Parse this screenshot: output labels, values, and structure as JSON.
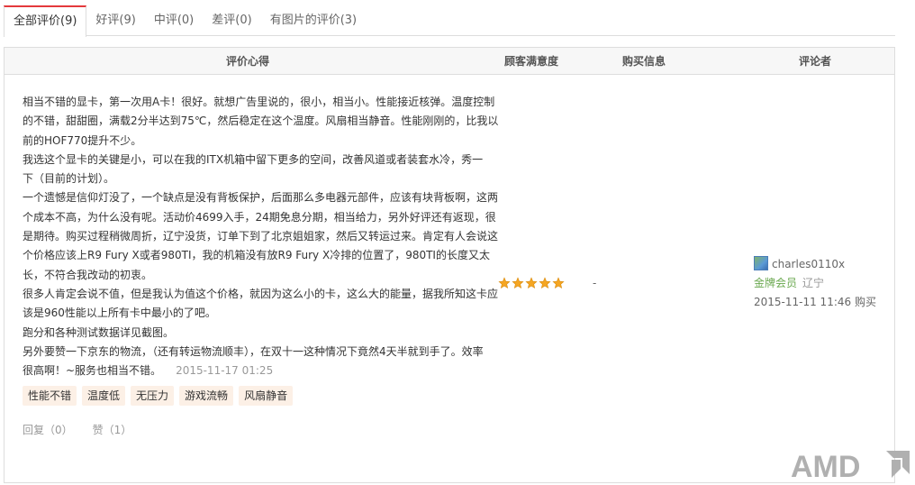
{
  "tabs": [
    {
      "label": "全部评价(9)",
      "active": true
    },
    {
      "label": "好评(9)"
    },
    {
      "label": "中评(0)"
    },
    {
      "label": "差评(0)"
    },
    {
      "label": "有图片的评价(3)"
    }
  ],
  "table_header": {
    "content": "评价心得",
    "satisfaction": "顾客满意度",
    "purchase_info": "购买信息",
    "reviewer": "评论者"
  },
  "review": {
    "lines": [
      "相当不错的显卡，第一次用A卡！很好。就想广告里说的，很小，相当小。性能接近核弹。温度控制",
      "的不错，甜甜圈，满载2分半达到75℃，然后稳定在这个温度。风扇相当静音。性能刚刚的，比我以",
      "前的HOF770提升不少。",
      "我选这个显卡的关键是小，可以在我的ITX机箱中留下更多的空间，改善风道或者装套水冷，秀一",
      "下（目前的计划）。",
      "一个遗憾是信仰灯没了，一个缺点是没有背板保护，后面那么多电器元部件，应该有块背板啊，这两",
      "个成本不高，为什么没有呢。活动价4699入手，24期免息分期，相当给力，另外好评还有返现，很",
      "是期待。购买过程稍微周折，辽宁没货，订单下到了北京姐姐家，然后又转运过来。肯定有人会说这",
      "个价格应该上R9 Fury X或者980TI，我的机箱没有放R9 Fury X冷排的位置了，980TI的长度又太",
      "长，不符合我改动的初衷。",
      "很多人肯定会说不值，但是我认为值这个价格，就因为这么小的卡，这么大的能量，据我所知这卡应",
      "该是960性能以上所有卡中最小的了吧。",
      "跑分和各种测试数据详见截图。",
      "另外要赞一下京东的物流，（还有转运物流顺丰），在双十一这种情况下竟然4天半就到手了。效率",
      "很高啊！~服务也相当不错。"
    ],
    "time": "2015-11-17 01:25",
    "tags": [
      "性能不错",
      "温度低",
      "无压力",
      "游戏流畅",
      "风扇静音"
    ],
    "reply": "回复（0）",
    "like": "赞（1）",
    "rating": 5,
    "purchase_info": "-",
    "reviewer": {
      "name": "charles0110x",
      "level": "金牌会员",
      "region": "辽宁",
      "buy_time": "2015-11-11 11:46 购买"
    }
  },
  "watermark": {
    "text": "AMD",
    "color": "#b0b0b0"
  },
  "colors": {
    "accent": "#e4393c",
    "star": "#f5a623",
    "level": "#6aa84f",
    "tag_bg": "#fcf0e6"
  }
}
